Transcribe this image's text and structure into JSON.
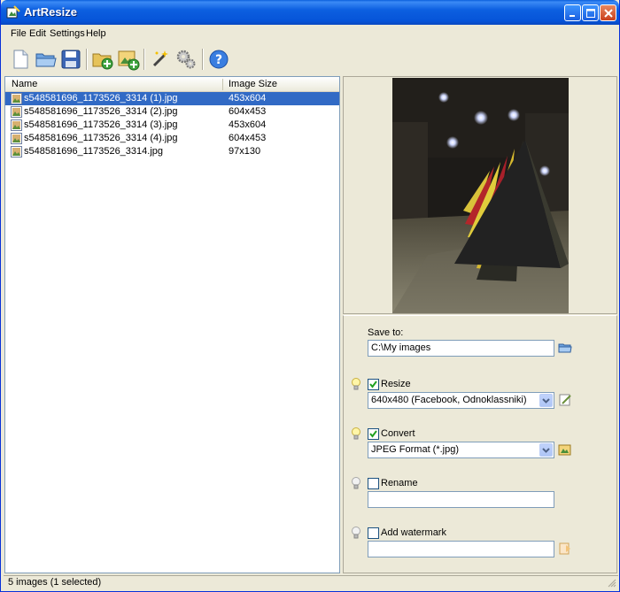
{
  "window": {
    "title": "ArtResize"
  },
  "menu": [
    "File",
    "Edit",
    "Settings",
    "Help"
  ],
  "toolbar": {
    "icons": [
      "new-icon",
      "open-folder-icon",
      "save-icon",
      "add-folder-icon",
      "add-image-icon",
      "magic-wand-icon",
      "settings-gears-icon",
      "help-icon"
    ]
  },
  "filelist": {
    "columns": [
      "Name",
      "Image Size"
    ],
    "rows": [
      {
        "name": "s548581696_1173526_3314 (1).jpg",
        "size": "453x604",
        "selected": true
      },
      {
        "name": "s548581696_1173526_3314 (2).jpg",
        "size": "604x453",
        "selected": false
      },
      {
        "name": "s548581696_1173526_3314 (3).jpg",
        "size": "453x604",
        "selected": false
      },
      {
        "name": "s548581696_1173526_3314 (4).jpg",
        "size": "604x453",
        "selected": false
      },
      {
        "name": "s548581696_1173526_3314.jpg",
        "size": "97x130",
        "selected": false
      }
    ]
  },
  "options": {
    "save_to_label": "Save to:",
    "save_to_value": "C:\\My images",
    "resize": {
      "label": "Resize",
      "checked": true,
      "value": "640x480 (Facebook, Odnoklassniki)"
    },
    "convert": {
      "label": "Convert",
      "checked": true,
      "value": "JPEG Format (*.jpg)"
    },
    "rename": {
      "label": "Rename",
      "checked": false,
      "value": ""
    },
    "watermark": {
      "label": "Add watermark",
      "checked": false,
      "value": ""
    }
  },
  "status": {
    "text": "5 images (1 selected)"
  },
  "colors": {
    "selection": "#316ac5",
    "titlebar": "#0654d8"
  }
}
